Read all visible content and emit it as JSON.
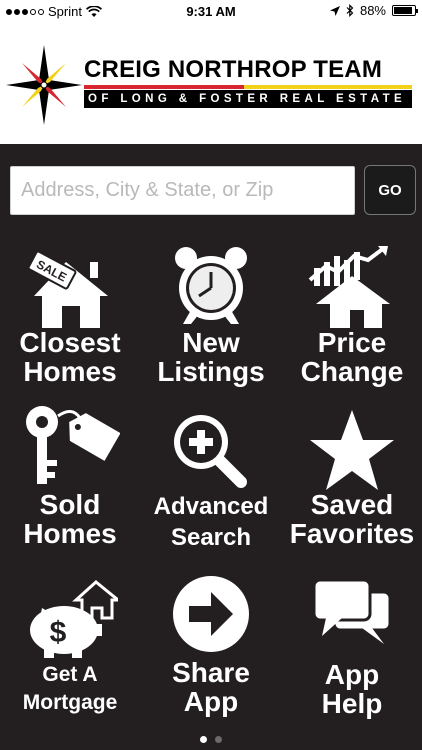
{
  "status_bar": {
    "carrier": "Sprint",
    "time": "9:31 AM",
    "battery": "88%",
    "battery_fraction": 0.88
  },
  "header": {
    "brand_name": "CREIG NORTHROP TEAM",
    "brand_subtitle": "OF LONG & FOSTER REAL ESTATE",
    "accent_red": "#d7262f",
    "accent_yellow": "#f3d21c"
  },
  "search": {
    "placeholder": "Address, City & State, or Zip",
    "value": "",
    "go_label": "GO"
  },
  "tiles": [
    {
      "line1": "Closest",
      "line2": "Homes",
      "icon": "sale-house-icon"
    },
    {
      "line1": "New",
      "line2": "Listings",
      "icon": "alarm-clock-icon"
    },
    {
      "line1": "Price",
      "line2": "Change",
      "icon": "price-chart-house-icon"
    },
    {
      "line1": "Sold",
      "line2": "Homes",
      "icon": "key-tag-icon"
    },
    {
      "line1": "Advanced",
      "line2": "Search",
      "icon": "magnifier-plus-icon"
    },
    {
      "line1": "Saved",
      "line2": "Favorites",
      "icon": "star-icon"
    },
    {
      "line1": "Get A",
      "line2": "Mortgage",
      "icon": "piggy-bank-house-icon"
    },
    {
      "line1": "Share",
      "line2": "App",
      "icon": "arrow-circle-icon"
    },
    {
      "line1": "App",
      "line2": "Help",
      "icon": "speech-bubbles-icon"
    }
  ],
  "pagination": {
    "total": 2,
    "active": 1
  }
}
